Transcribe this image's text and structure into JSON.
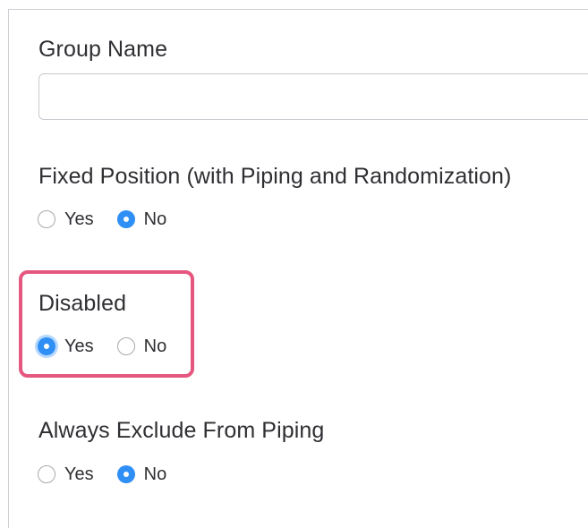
{
  "fields": {
    "group_name": {
      "label": "Group Name",
      "value": ""
    },
    "fixed_position": {
      "label": "Fixed Position (with Piping and Randomization)",
      "options": [
        "Yes",
        "No"
      ],
      "selected": "No"
    },
    "disabled": {
      "label": "Disabled",
      "options": [
        "Yes",
        "No"
      ],
      "selected": "Yes"
    },
    "exclude_piping": {
      "label": "Always Exclude From Piping",
      "options": [
        "Yes",
        "No"
      ],
      "selected": "No"
    }
  },
  "colors": {
    "accent": "#2f8ff5",
    "highlight": "#e5577e",
    "text": "#2f2f33",
    "border": "#c8c8ce"
  }
}
